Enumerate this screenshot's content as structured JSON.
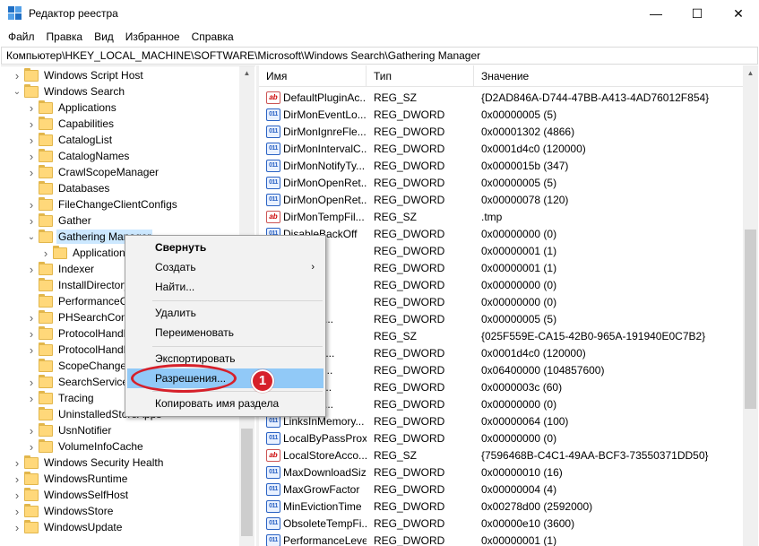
{
  "window": {
    "title": "Редактор реестра",
    "buttons": {
      "minimize": "—",
      "maximize": "☐",
      "close": "✕"
    }
  },
  "menu": [
    "Файл",
    "Правка",
    "Вид",
    "Избранное",
    "Справка"
  ],
  "address": "Компьютер\\HKEY_LOCAL_MACHINE\\SOFTWARE\\Microsoft\\Windows Search\\Gathering Manager",
  "tree": [
    {
      "label": "Windows Script Host",
      "indent": 0,
      "chevron": "right"
    },
    {
      "label": "Windows Search",
      "indent": 0,
      "chevron": "down"
    },
    {
      "label": "Applications",
      "indent": 1,
      "chevron": "right"
    },
    {
      "label": "Capabilities",
      "indent": 1,
      "chevron": "right"
    },
    {
      "label": "CatalogList",
      "indent": 1,
      "chevron": "right"
    },
    {
      "label": "CatalogNames",
      "indent": 1,
      "chevron": "right"
    },
    {
      "label": "CrawlScopeManager",
      "indent": 1,
      "chevron": "right"
    },
    {
      "label": "Databases",
      "indent": 1,
      "chevron": "none"
    },
    {
      "label": "FileChangeClientConfigs",
      "indent": 1,
      "chevron": "right"
    },
    {
      "label": "Gather",
      "indent": 1,
      "chevron": "right"
    },
    {
      "label": "Gathering Manager",
      "indent": 1,
      "chevron": "down",
      "selected": true
    },
    {
      "label": "Applications",
      "indent": 2,
      "chevron": "right"
    },
    {
      "label": "Indexer",
      "indent": 1,
      "chevron": "right"
    },
    {
      "label": "InstallDirectory",
      "indent": 1,
      "chevron": "none"
    },
    {
      "label": "PerformanceCounters",
      "indent": 1,
      "chevron": "none"
    },
    {
      "label": "PHSearchConnectors",
      "indent": 1,
      "chevron": "right"
    },
    {
      "label": "ProtocolHandlers",
      "indent": 1,
      "chevron": "right"
    },
    {
      "label": "ProtocolHandlerSettings",
      "indent": 1,
      "chevron": "right"
    },
    {
      "label": "ScopeChangeNotifications",
      "indent": 1,
      "chevron": "none"
    },
    {
      "label": "SearchService",
      "indent": 1,
      "chevron": "right"
    },
    {
      "label": "Tracing",
      "indent": 1,
      "chevron": "right"
    },
    {
      "label": "UninstalledStoreApps",
      "indent": 1,
      "chevron": "none"
    },
    {
      "label": "UsnNotifier",
      "indent": 1,
      "chevron": "right"
    },
    {
      "label": "VolumeInfoCache",
      "indent": 1,
      "chevron": "right"
    },
    {
      "label": "Windows Security Health",
      "indent": 0,
      "chevron": "right"
    },
    {
      "label": "WindowsRuntime",
      "indent": 0,
      "chevron": "right"
    },
    {
      "label": "WindowsSelfHost",
      "indent": 0,
      "chevron": "right"
    },
    {
      "label": "WindowsStore",
      "indent": 0,
      "chevron": "right"
    },
    {
      "label": "WindowsUpdate",
      "indent": 0,
      "chevron": "right"
    }
  ],
  "list": {
    "headers": {
      "name": "Имя",
      "type": "Тип",
      "value": "Значение"
    },
    "rows": [
      {
        "name": "DefaultPluginAc...",
        "type": "REG_SZ",
        "value": "{D2AD846A-D744-47BB-A413-4AD76012F854}",
        "icon": "ab"
      },
      {
        "name": "DirMonEventLo...",
        "type": "REG_DWORD",
        "value": "0x00000005 (5)",
        "icon": "011"
      },
      {
        "name": "DirMonIgnreFle...",
        "type": "REG_DWORD",
        "value": "0x00001302 (4866)",
        "icon": "011"
      },
      {
        "name": "DirMonIntervalC...",
        "type": "REG_DWORD",
        "value": "0x0001d4c0 (120000)",
        "icon": "011"
      },
      {
        "name": "DirMonNotifyTy...",
        "type": "REG_DWORD",
        "value": "0x0000015b (347)",
        "icon": "011"
      },
      {
        "name": "DirMonOpenRet...",
        "type": "REG_DWORD",
        "value": "0x00000005 (5)",
        "icon": "011"
      },
      {
        "name": "DirMonOpenRet...",
        "type": "REG_DWORD",
        "value": "0x00000078 (120)",
        "icon": "011"
      },
      {
        "name": "DirMonTempFil...",
        "type": "REG_SZ",
        "value": ".tmp",
        "icon": "ab"
      },
      {
        "name": "DisableBackOff",
        "type": "REG_DWORD",
        "value": "0x00000000 (0)",
        "icon": "011"
      },
      {
        "name": "...ckOff...",
        "type": "REG_DWORD",
        "value": "0x00000001 (1)",
        "icon": "011"
      },
      {
        "name": "...ckOff...",
        "type": "REG_DWORD",
        "value": "0x00000001 (1)",
        "icon": "011"
      },
      {
        "name": "...ckOff...",
        "type": "REG_DWORD",
        "value": "0x00000000 (0)",
        "icon": "011"
      },
      {
        "name": "...gister",
        "type": "REG_DWORD",
        "value": "0x00000000 (0)",
        "icon": "011"
      },
      {
        "name": "...heckFr...",
        "type": "REG_DWORD",
        "value": "0x00000005 (5)",
        "icon": "011"
      },
      {
        "name": "...ret",
        "type": "REG_SZ",
        "value": "{025F559E-CA15-42B0-965A-191940E0C7B2}",
        "icon": "ab"
      },
      {
        "name": "...Proces...",
        "type": "REG_DWORD",
        "value": "0x0001d4c0 (120000)",
        "icon": "011"
      },
      {
        "name": "...essMe...",
        "type": "REG_DWORD",
        "value": "0x06400000 (104857600)",
        "icon": "011"
      },
      {
        "name": "...eartbe...",
        "type": "REG_DWORD",
        "value": "0x0000003c (60)",
        "icon": "011"
      },
      {
        "name": "...tCNErr...",
        "type": "REG_DWORD",
        "value": "0x00000000 (0)",
        "icon": "011"
      },
      {
        "name": "LinksInMemory...",
        "type": "REG_DWORD",
        "value": "0x00000064 (100)",
        "icon": "011"
      },
      {
        "name": "LocalByPassProxy",
        "type": "REG_DWORD",
        "value": "0x00000000 (0)",
        "icon": "011"
      },
      {
        "name": "LocalStoreAcco...",
        "type": "REG_SZ",
        "value": "{7596468B-C4C1-49AA-BCF3-73550371DD50}",
        "icon": "ab"
      },
      {
        "name": "MaxDownloadSize",
        "type": "REG_DWORD",
        "value": "0x00000010 (16)",
        "icon": "011"
      },
      {
        "name": "MaxGrowFactor",
        "type": "REG_DWORD",
        "value": "0x00000004 (4)",
        "icon": "011"
      },
      {
        "name": "MinEvictionTime",
        "type": "REG_DWORD",
        "value": "0x00278d00 (2592000)",
        "icon": "011"
      },
      {
        "name": "ObsoleteTempFi...",
        "type": "REG_DWORD",
        "value": "0x00000e10 (3600)",
        "icon": "011"
      },
      {
        "name": "PerformanceLevel",
        "type": "REG_DWORD",
        "value": "0x00000001 (1)",
        "icon": "011"
      }
    ]
  },
  "context_menu": {
    "collapse": "Свернуть",
    "create": "Создать",
    "find": "Найти...",
    "delete": "Удалить",
    "rename": "Переименовать",
    "export": "Экспортировать",
    "permissions": "Разрешения...",
    "copy_key_name": "Копировать имя раздела"
  },
  "annotation": {
    "badge": "1",
    "color": "#d6202a"
  },
  "colors": {
    "selection": "#cce8ff",
    "menu_highlight": "#91c9f7",
    "folder": "#ffd87a"
  }
}
